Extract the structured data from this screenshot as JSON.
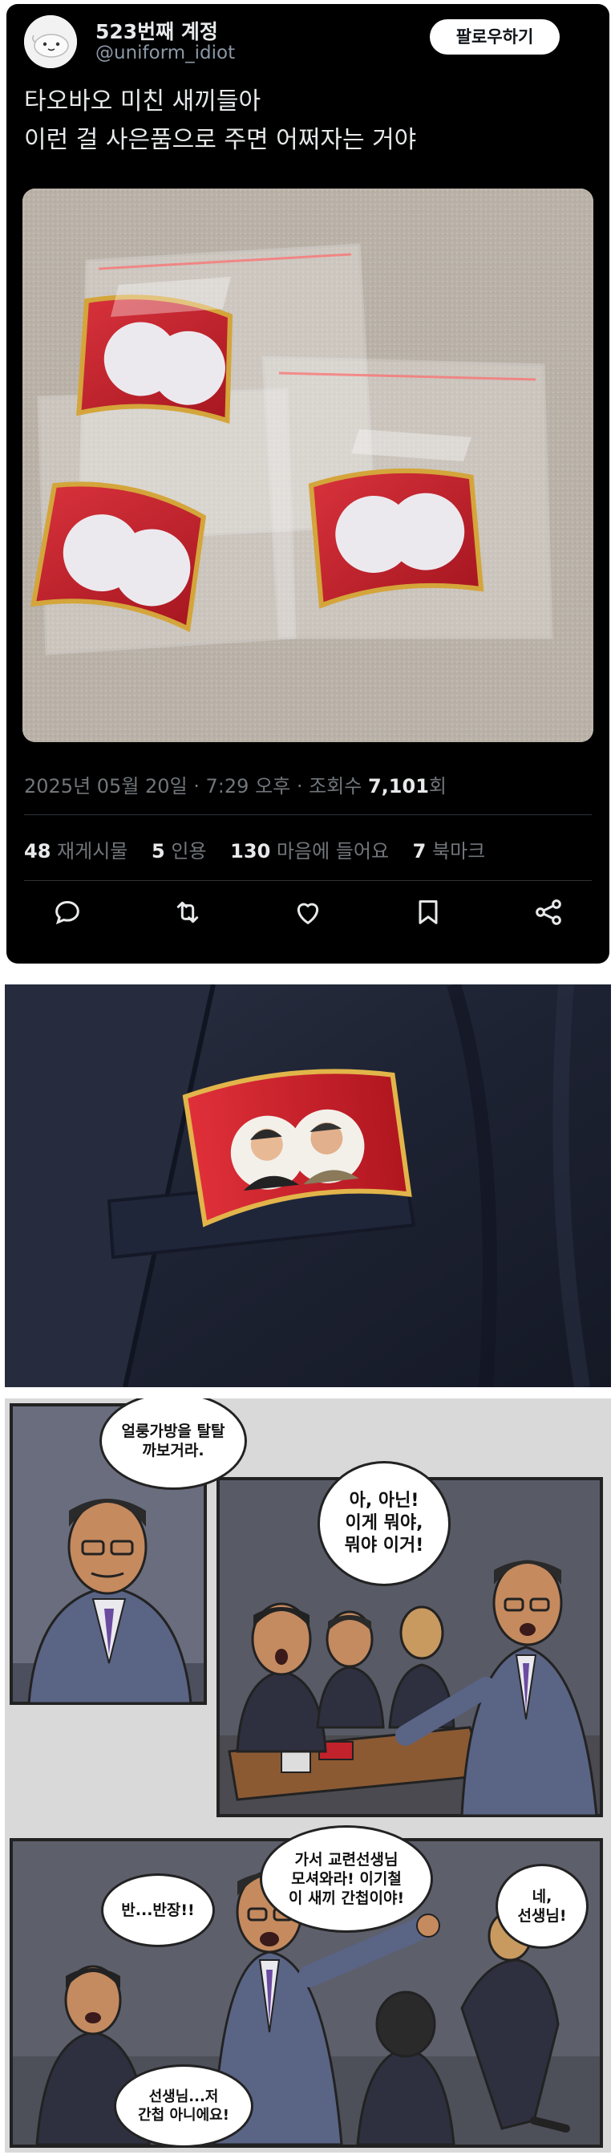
{
  "tweet": {
    "display_name": "523번째 계정",
    "handle": "@uniform_idiot",
    "follow_label": "팔로우하기",
    "text_line1": "타오바오 미친 새끼들아",
    "text_line2": "이런 걸 사은품으로 주면 어쩌자는 거야",
    "timestamp": "2025년 05월 20일 · 7:29 오후 · 조회수 ",
    "views": "7,101",
    "views_suffix": "회",
    "stats": {
      "retweets_count": "48",
      "retweets_label": "재게시물",
      "quotes_count": "5",
      "quotes_label": "인용",
      "likes_count": "130",
      "likes_label": "마음에 들어요",
      "bookmarks_count": "7",
      "bookmarks_label": "북마크"
    },
    "actions": [
      "reply-icon",
      "retweet-icon",
      "like-icon",
      "bookmark-icon",
      "share-icon"
    ]
  },
  "comic": {
    "bubble1": "얼룽가방을 탈탈\n까보거라.",
    "bubble2": "아, 아닌!\n이게 뭐야,\n뭐야 이거!",
    "bubble3": "가서 교련선생님\n모셔와라! 이기철\n이 새끼 간첩이야!",
    "bubble4": "반...반장!!",
    "bubble5": "네,\n선생님!",
    "bubble6": "선생님...저\n간첩 아니에요!"
  },
  "colors": {
    "tweet_bg": "#000000",
    "text_primary": "#e7e9ea",
    "text_secondary": "#71767b",
    "flag_red": "#c8202b",
    "gold": "#d4a53a"
  }
}
